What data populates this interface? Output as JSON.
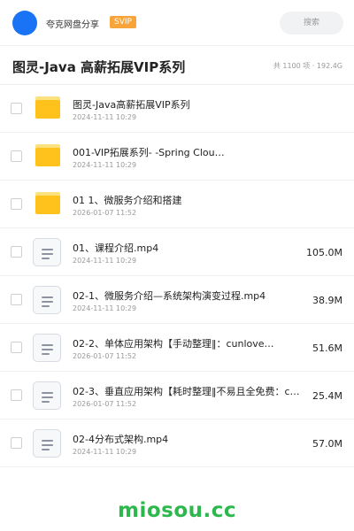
{
  "header": {
    "share_name": "夸克网盘分享",
    "badge": "SVIP",
    "search_placeholder": "搜索"
  },
  "folder": {
    "title": "图灵-Java 高薪拓展VIP系列",
    "summary": "共 1100 项 · 192.4G"
  },
  "files": [
    {
      "type": "folder",
      "name": "图灵-Java高薪拓展VIP系列",
      "date": "2024-11-11 10:29",
      "size": ""
    },
    {
      "type": "folder",
      "name": "001-VIP拓展系列- -Spring Clou…",
      "date": "2024-11-11 10:29",
      "size": ""
    },
    {
      "type": "folder",
      "name": "01 1、微服务介绍和搭建",
      "date": "2026-01-07 11:52",
      "size": ""
    },
    {
      "type": "file",
      "name": "01、课程介绍.mp4",
      "date": "2024-11-11 10:29",
      "size": "105.0M"
    },
    {
      "type": "file",
      "name": "02-1、微服务介绍—系统架构演变过程.mp4",
      "date": "2024-11-11 10:29",
      "size": "38.9M"
    },
    {
      "type": "file",
      "name": "02-2、单体应用架构【手动整理‖：cunlove…",
      "date": "2026-01-07 11:52",
      "size": "51.6M"
    },
    {
      "type": "file",
      "name": "02-3、垂直应用架构【耗时整理‖不易且全免费：c…",
      "date": "2026-01-07 11:52",
      "size": "25.4M"
    },
    {
      "type": "file",
      "name": "02-4分布式架构.mp4",
      "date": "2024-11-11 10:29",
      "size": "57.0M"
    }
  ],
  "watermark": "miosou.cc",
  "colors": {
    "accent": "#1a73f5",
    "badge": "#f7a43b",
    "folder": "#ffc21c",
    "watermark": "#2db84d"
  }
}
